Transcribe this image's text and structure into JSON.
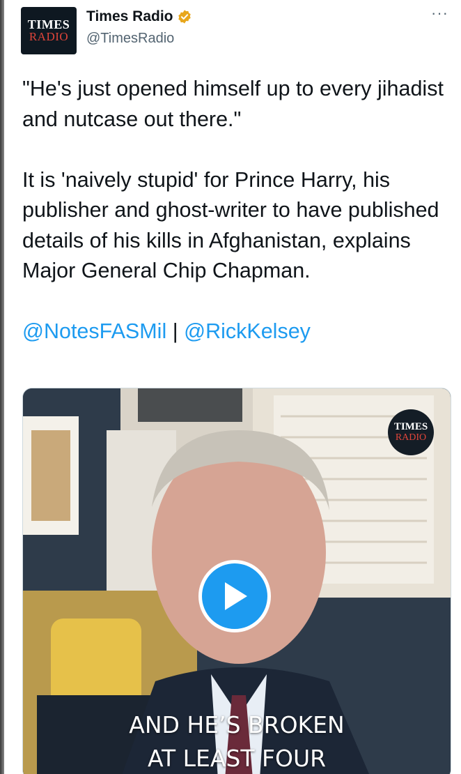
{
  "account": {
    "avatar_line1": "TIMES",
    "avatar_line2": "RADIO",
    "display_name": "Times Radio",
    "handle": "@TimesRadio",
    "verified_badge_color": "#e8a71c"
  },
  "menu": {
    "more_icon": "more-options-icon",
    "more_label": "···"
  },
  "tweet": {
    "paragraph1": "\"He's just opened himself up to every jihadist and nutcase out there.\"",
    "paragraph2": "It is 'naively stupid' for Prince Harry, his publisher and ghost-writer to have published details of his kills in Afghanistan, explains Major General Chip Chapman.",
    "mention1": "@NotesFASMil",
    "separator": " | ",
    "mention2": "@RickKelsey"
  },
  "video": {
    "logo_line1": "TIMES",
    "logo_line2": "RADIO",
    "play_icon": "play-icon",
    "caption_line1": "AND HE’S BROKEN",
    "caption_line2": "AT LEAST FOUR"
  },
  "colors": {
    "link": "#1d9bf0",
    "play_button": "#1d9bf0",
    "text": "#0f1419",
    "secondary": "#536471"
  }
}
